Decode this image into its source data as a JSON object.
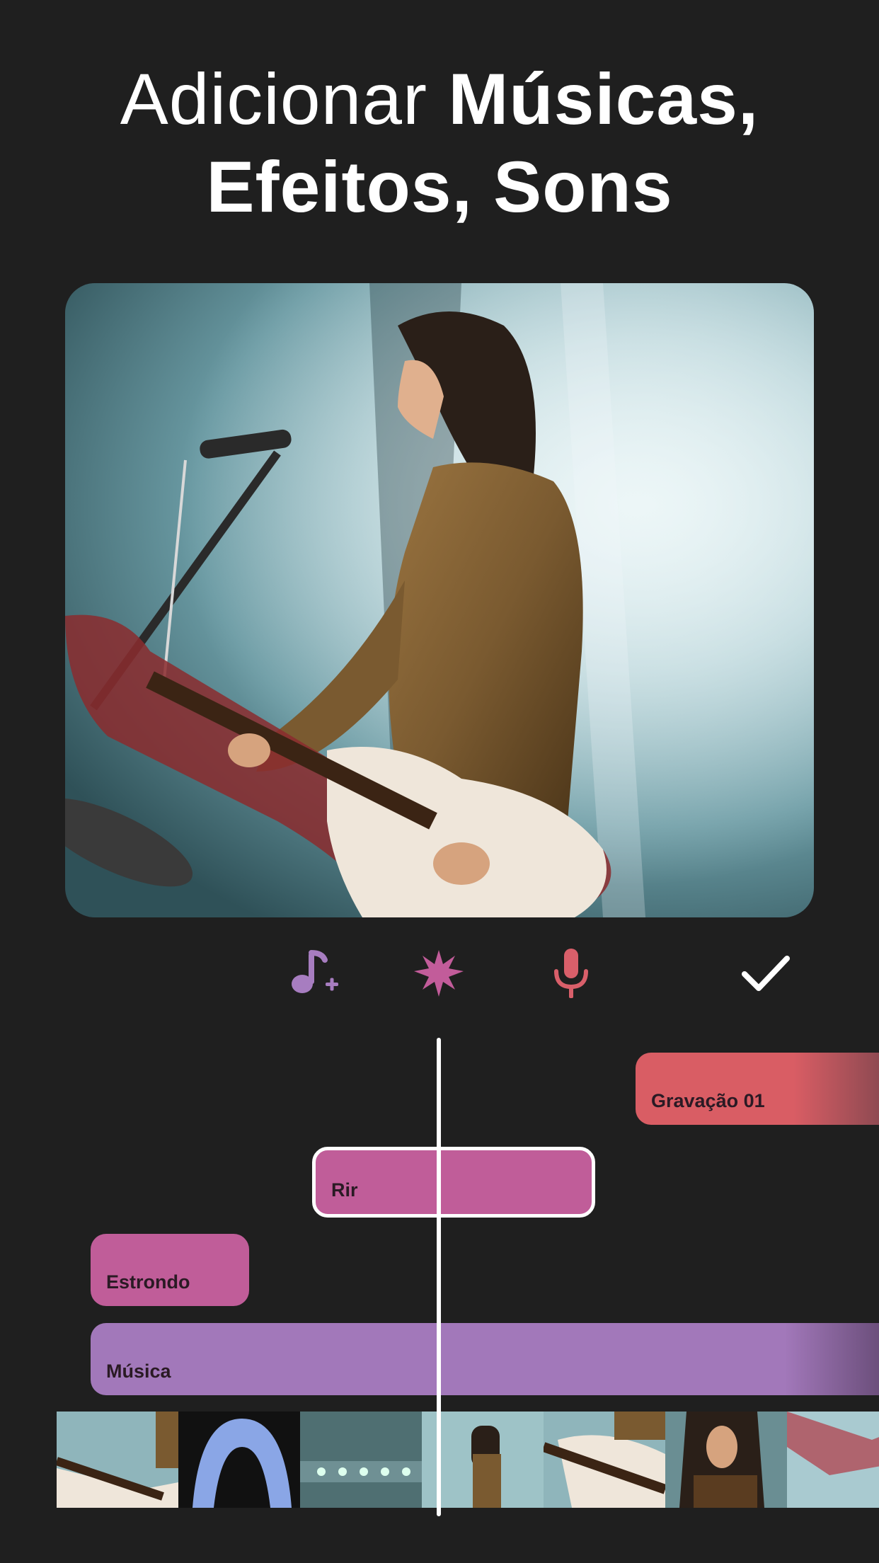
{
  "headline": {
    "line1_regular": "Adicionar ",
    "line1_bold": "Músicas,",
    "line2_bold": "Efeitos, Sons"
  },
  "preview": {
    "image": "concert-guitarist-photo"
  },
  "toolbar": {
    "icons": [
      "music-add-icon",
      "effects-burst-icon",
      "microphone-icon",
      "checkmark-icon"
    ],
    "colors": {
      "music": "#a77dc0",
      "effects": "#c25c9a",
      "mic": "#d95f6a",
      "check": "#ffffff"
    }
  },
  "tracks": {
    "recording": {
      "label": "Gravação 01",
      "color": "#d95d64"
    },
    "laugh": {
      "label": "Rir",
      "color": "#c05d99"
    },
    "boom": {
      "label": "Estrondo",
      "color": "#c05d99"
    },
    "music": {
      "label": "Música",
      "color": "#a278ba"
    }
  },
  "filmstrip": {
    "frames": 7
  }
}
